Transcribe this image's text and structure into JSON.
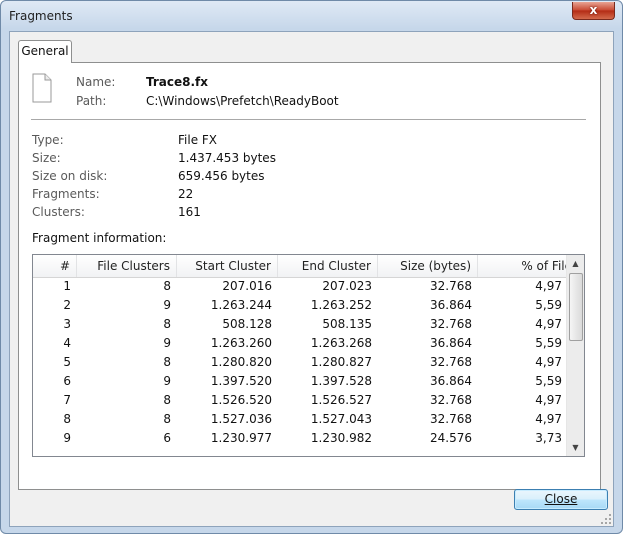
{
  "window": {
    "title": "Fragments",
    "close_glyph": "x"
  },
  "tab": {
    "label": "General"
  },
  "file": {
    "icon": "document-icon",
    "name_label": "Name:",
    "name": "Trace8.fx",
    "path_label": "Path:",
    "path": "C:\\Windows\\Prefetch\\ReadyBoot"
  },
  "props": [
    {
      "label": "Type:",
      "value": "File FX"
    },
    {
      "label": "Size:",
      "value": "1.437.453 bytes"
    },
    {
      "label": "Size on disk:",
      "value": "659.456 bytes"
    },
    {
      "label": "Fragments:",
      "value": "22"
    },
    {
      "label": "Clusters:",
      "value": "161"
    }
  ],
  "fragments": {
    "section_label": "Fragment information:",
    "columns": [
      "#",
      "File Clusters",
      "Start Cluster",
      "End Cluster",
      "Size (bytes)",
      "% of File"
    ],
    "rows": [
      [
        "1",
        "8",
        "207.016",
        "207.023",
        "32.768",
        "4,97"
      ],
      [
        "2",
        "9",
        "1.263.244",
        "1.263.252",
        "36.864",
        "5,59"
      ],
      [
        "3",
        "8",
        "508.128",
        "508.135",
        "32.768",
        "4,97"
      ],
      [
        "4",
        "9",
        "1.263.260",
        "1.263.268",
        "36.864",
        "5,59"
      ],
      [
        "5",
        "8",
        "1.280.820",
        "1.280.827",
        "32.768",
        "4,97"
      ],
      [
        "6",
        "9",
        "1.397.520",
        "1.397.528",
        "36.864",
        "5,59"
      ],
      [
        "7",
        "8",
        "1.526.520",
        "1.526.527",
        "32.768",
        "4,97"
      ],
      [
        "8",
        "8",
        "1.527.036",
        "1.527.043",
        "32.768",
        "4,97"
      ],
      [
        "9",
        "6",
        "1.230.977",
        "1.230.982",
        "24.576",
        "3,73"
      ]
    ]
  },
  "buttons": {
    "close_label": "Close"
  }
}
